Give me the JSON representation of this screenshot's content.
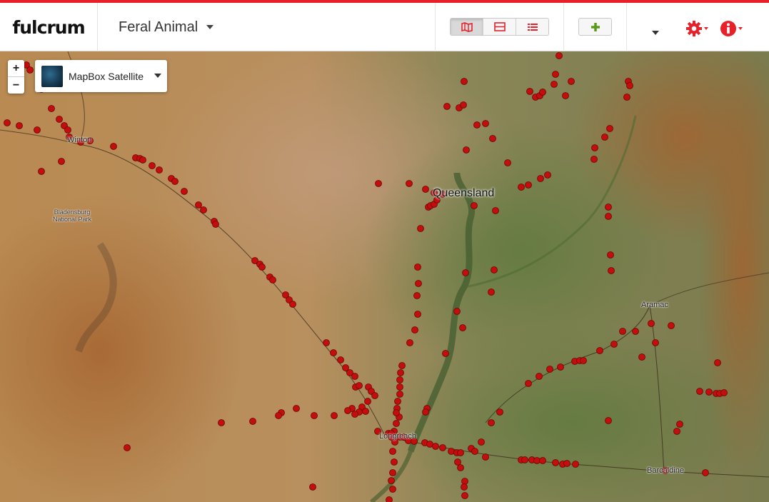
{
  "brand": {
    "logo_text": "fulcrum"
  },
  "app_selector": {
    "label": "Feral Animal"
  },
  "view_toggle": {
    "buttons": [
      {
        "name": "map-view",
        "icon": "map-icon",
        "active": true
      },
      {
        "name": "split-view",
        "icon": "split-icon",
        "active": false
      },
      {
        "name": "table-view",
        "icon": "list-icon",
        "active": false
      }
    ]
  },
  "toolbar": {
    "add_icon": "plus-icon",
    "settings_icon": "gear-icon",
    "info_icon": "info-icon"
  },
  "colors": {
    "accent": "#e8202a",
    "add": "#5a9a1b",
    "marker": "#c40d0d"
  },
  "map": {
    "zoom_in": "+",
    "zoom_out": "−",
    "layer": {
      "label": "MapBox Satellite"
    },
    "places": {
      "winton": "Winton",
      "park": "Bladensburg\nNational Park",
      "queensland": "Queensland",
      "aramac": "Aramac",
      "longreach": "Longreach",
      "barcaldine": "Barcaldine"
    }
  }
}
